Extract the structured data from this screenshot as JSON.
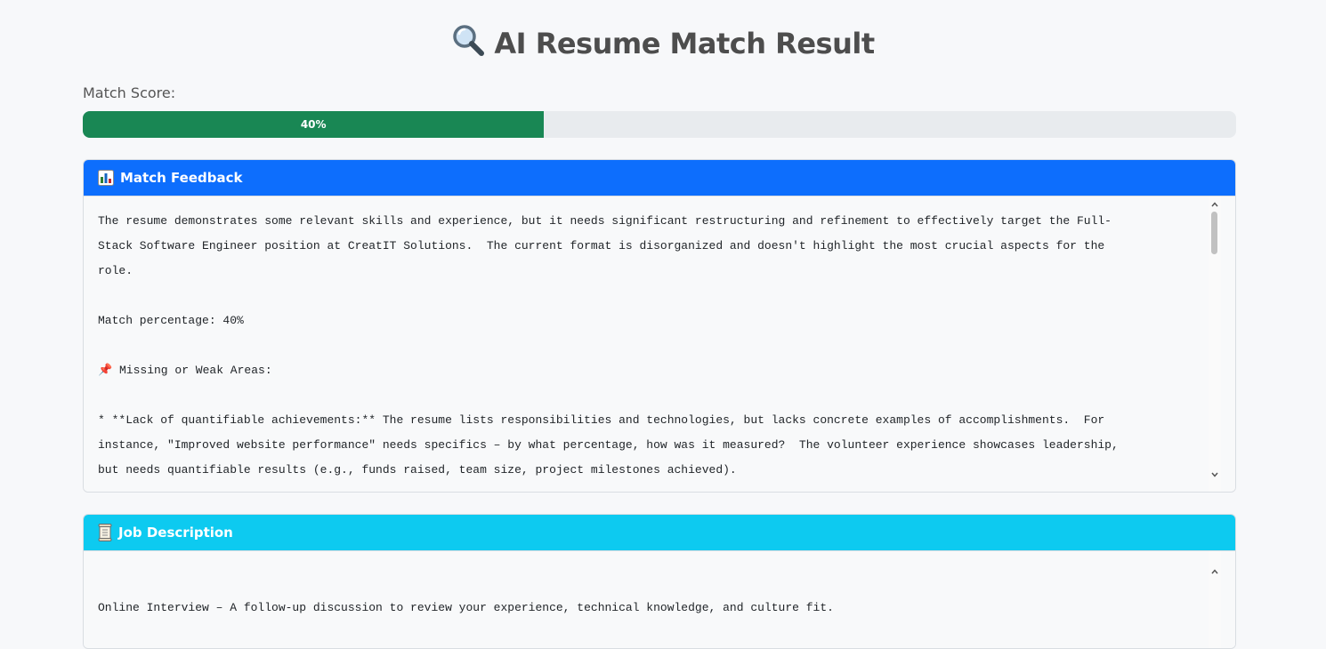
{
  "page": {
    "title": "AI Resume Match Result",
    "title_icon": "magnifier-icon"
  },
  "score": {
    "label": "Match Score:",
    "value_percent": 40,
    "value_text": "40%",
    "bar_color": "#198754"
  },
  "feedback": {
    "header": "Match Feedback",
    "header_icon": "bar-chart-icon",
    "header_color": "#0d6efd",
    "lines": [
      "The resume demonstrates some relevant skills and experience, but it needs significant restructuring and refinement to effectively target the Full-",
      "Stack Software Engineer position at CreatIT Solutions.  The current format is disorganized and doesn't highlight the most crucial aspects for the",
      "role.",
      "",
      "Match percentage: 40%",
      "",
      "📌 Missing or Weak Areas:",
      "",
      "* **Lack of quantifiable achievements:** The resume lists responsibilities and technologies, but lacks concrete examples of accomplishments.  For",
      "instance, \"Improved website performance\" needs specifics – by what percentage, how was it measured?  The volunteer experience showcases leadership,",
      "but needs quantifiable results (e.g., funds raised, team size, project milestones achieved)."
    ]
  },
  "job_description": {
    "header": "Job Description",
    "header_icon": "scroll-icon",
    "header_color": "#0dcaf0",
    "lines": [
      "",
      "Online Interview – A follow-up discussion to review your experience, technical knowledge, and culture fit."
    ]
  }
}
